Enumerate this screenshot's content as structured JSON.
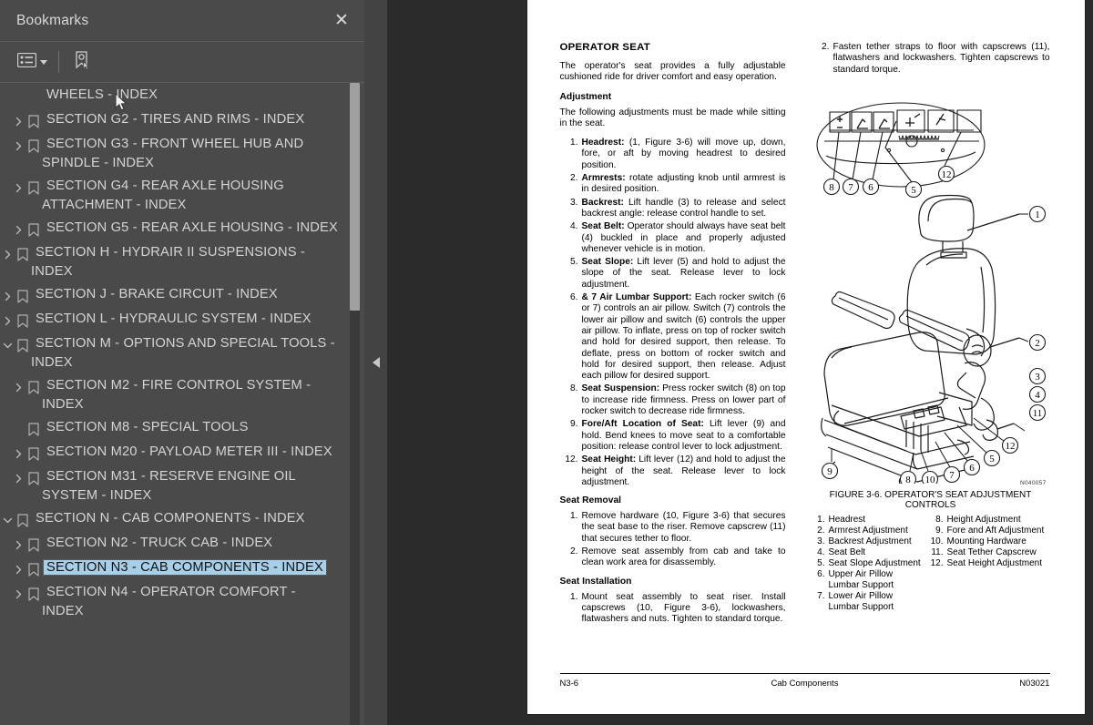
{
  "panel": {
    "title": "Bookmarks",
    "close_label": "✕",
    "toolbar": {
      "options_icon": "list-options-icon",
      "new_bookmark_icon": "new-bookmark-icon"
    },
    "bookmarks": [
      {
        "label": "WHEELS - INDEX",
        "depth": 1,
        "expander": "none",
        "selected": false,
        "continuation": true
      },
      {
        "label": "SECTION G2 - TIRES AND RIMS - INDEX",
        "depth": 1,
        "expander": "collapsed",
        "selected": false
      },
      {
        "label": "SECTION G3 - FRONT WHEEL HUB AND SPINDLE - INDEX",
        "depth": 1,
        "expander": "collapsed",
        "selected": false
      },
      {
        "label": "SECTION G4 - REAR AXLE HOUSING ATTACHMENT - INDEX",
        "depth": 1,
        "expander": "collapsed",
        "selected": false
      },
      {
        "label": "SECTION G5 - REAR AXLE HOUSING - INDEX",
        "depth": 1,
        "expander": "collapsed",
        "selected": false
      },
      {
        "label": "SECTION H - HYDRAIR II SUSPENSIONS - INDEX",
        "depth": 0,
        "expander": "collapsed",
        "selected": false
      },
      {
        "label": "SECTION J - BRAKE CIRCUIT - INDEX",
        "depth": 0,
        "expander": "collapsed",
        "selected": false
      },
      {
        "label": "SECTION L - HYDRAULIC SYSTEM - INDEX",
        "depth": 0,
        "expander": "collapsed",
        "selected": false
      },
      {
        "label": "SECTION M - OPTIONS AND SPECIAL TOOLS - INDEX",
        "depth": 0,
        "expander": "expanded",
        "selected": false
      },
      {
        "label": "SECTION M2 - FIRE CONTROL SYSTEM - INDEX",
        "depth": 1,
        "expander": "collapsed",
        "selected": false
      },
      {
        "label": "SECTION M8 - SPECIAL TOOLS",
        "depth": 1,
        "expander": "none",
        "selected": false
      },
      {
        "label": "SECTION M20 - PAYLOAD METER III - INDEX",
        "depth": 1,
        "expander": "collapsed",
        "selected": false
      },
      {
        "label": "SECTION M31 - RESERVE ENGINE OIL SYSTEM - INDEX",
        "depth": 1,
        "expander": "collapsed",
        "selected": false
      },
      {
        "label": "SECTION N - CAB COMPONENTS - INDEX",
        "depth": 0,
        "expander": "expanded",
        "selected": false
      },
      {
        "label": "SECTION N2 - TRUCK CAB - INDEX",
        "depth": 1,
        "expander": "collapsed",
        "selected": false
      },
      {
        "label": "SECTION N3 - CAB COMPONENTS - INDEX",
        "depth": 1,
        "expander": "collapsed",
        "selected": true
      },
      {
        "label": "SECTION N4 - OPERATOR COMFORT - INDEX",
        "depth": 1,
        "expander": "collapsed",
        "selected": false
      }
    ],
    "selected_color": "#a8cfe8"
  },
  "splitter": {
    "collapse_icon": "collapse-left-arrow-icon"
  },
  "document": {
    "left_column": {
      "title": "OPERATOR SEAT",
      "intro": "The operator's seat provides a fully adjustable cushioned ride for driver comfort and easy operation.",
      "adjustment_heading": "Adjustment",
      "adjustment_intro": "The following adjustments must be made while sitting in the seat.",
      "steps": [
        {
          "num": "1.",
          "lead": "Headrest:",
          "text": " (1, Figure 3-6) will move up, down, fore, or aft by moving headrest to desired position."
        },
        {
          "num": "2.",
          "lead": "Armrests:",
          "text": " rotate adjusting knob until armrest is in desired position."
        },
        {
          "num": "3.",
          "lead": "Backrest:",
          "text": " Lift handle (3) to release and select backrest angle: release control handle to set."
        },
        {
          "num": "4.",
          "lead": "Seat Belt:",
          "text": " Operator should always have seat belt (4) buckled in place and properly adjusted whenever vehicle is in motion."
        },
        {
          "num": "5.",
          "lead": "Seat Slope:",
          "text": " Lift lever (5) and hold to adjust the slope of the seat. Release lever to lock adjustment."
        },
        {
          "num": "6.",
          "lead": "& 7 Air Lumbar Support:",
          "text": " Each rocker switch (6 or 7) controls an air pillow. Switch (7) controls the lower air pillow and switch (6) controls the upper air pillow. To inflate, press on top of rocker switch and hold for desired support, then release. To deflate, press on bottom of rocker switch and hold for desired support, then release. Adjust each pillow for desired support."
        },
        {
          "num": "8.",
          "lead": "Seat Suspension:",
          "text": " Press rocker switch (8) on top to increase ride firmness. Press on lower part of rocker switch to decrease ride firmness."
        },
        {
          "num": "9.",
          "lead": "Fore/Aft Location of Seat:",
          "text": " Lift lever (9) and hold. Bend knees to move seat to a comfortable position: release control lever to lock adjustment."
        },
        {
          "num": "12.",
          "lead": "Seat Height:",
          "text": " Lift lever (12) and hold to adjust the height of the seat. Release lever to lock adjustment."
        }
      ],
      "removal_heading": "Seat Removal",
      "removal_steps": [
        {
          "num": "1.",
          "lead": "",
          "text": "Remove hardware (10, Figure 3-6) that secures the seat base to the riser. Remove capscrew (11) that secures tether to floor."
        },
        {
          "num": "2.",
          "lead": "",
          "text": "Remove seat assembly from cab and take to clean work area for disassembly."
        }
      ],
      "installation_heading": "Seat Installation",
      "installation_steps": [
        {
          "num": "1.",
          "lead": "",
          "text": "Mount seat assembly to seat riser. Install capscrews (10, Figure 3-6), lockwashers, flatwashers and nuts. Tighten to standard torque."
        }
      ]
    },
    "right_column": {
      "steps": [
        {
          "num": "2.",
          "lead": "",
          "text": "Fasten tether straps to floor with capscrews (11), flatwashers and lockwashers. Tighten capscrews to standard torque."
        }
      ],
      "figure": {
        "caption": "FIGURE 3-6. OPERATOR'S SEAT ADJUSTMENT CONTROLS",
        "drawing_code": "N040057",
        "callouts": [
          "1",
          "2",
          "3",
          "4",
          "5",
          "6",
          "7",
          "8",
          "9",
          "10",
          "11",
          "12"
        ],
        "legend_left": [
          {
            "num": "1.",
            "text": "Headrest"
          },
          {
            "num": "2.",
            "text": "Armrest Adjustment"
          },
          {
            "num": "3.",
            "text": "Backrest Adjustment"
          },
          {
            "num": "4.",
            "text": "Seat Belt"
          },
          {
            "num": "5.",
            "text": "Seat Slope Adjustment"
          },
          {
            "num": "6.",
            "text": "Upper Air Pillow Lumbar Support"
          },
          {
            "num": "7.",
            "text": "Lower Air Pillow Lumbar Support"
          }
        ],
        "legend_right": [
          {
            "num": "8.",
            "text": "Height Adjustment"
          },
          {
            "num": "9.",
            "text": "Fore and Aft Adjustment"
          },
          {
            "num": "10.",
            "text": "Mounting Hardware"
          },
          {
            "num": "11.",
            "text": "Seat Tether Capscrew"
          },
          {
            "num": "12.",
            "text": "Seat Height Adjustment"
          }
        ]
      }
    },
    "footer": {
      "left": "N3-6",
      "center": "Cab Components",
      "right": "N03021"
    }
  }
}
